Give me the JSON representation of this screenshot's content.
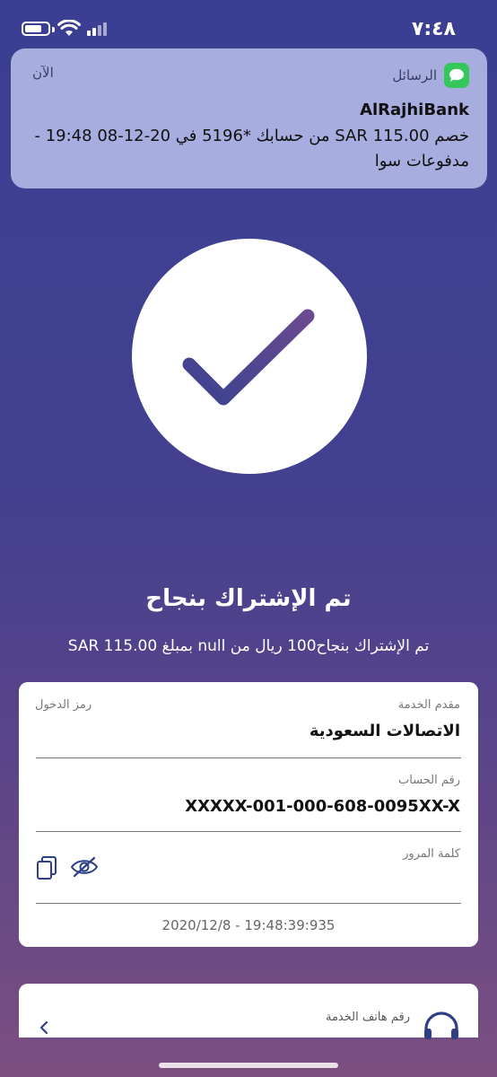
{
  "status_bar": {
    "time": "٧:٤٨"
  },
  "notification": {
    "app_name": "الرسائل",
    "time": "الآن",
    "title": "AlRajhiBank",
    "body": "خصم SAR 115.00 من حسابك *5196 في 20-12-08 19:48 - مدفوعات سوا"
  },
  "result": {
    "title": "تم الإشتراك بنجاح",
    "subtitle": "تم الإشتراك بنجاح100 ريال من null بمبلغ SAR 115.00"
  },
  "details": {
    "provider_label": "مقدم الخدمة",
    "provider_value": "الاتصالات السعودية",
    "access_code_label": "رمز الدخول",
    "account_label": "رقم الحساب",
    "account_value": "XXXXX-001-000-608-0095XX-X",
    "password_label": "كلمة المرور",
    "timestamp": "2020/12/8 - 19:48:39:935"
  },
  "service_phone": {
    "label": "رقم هاتف الخدمة"
  },
  "colors": {
    "accent": "#5d4a91",
    "notification_bg": "#a7addf"
  }
}
